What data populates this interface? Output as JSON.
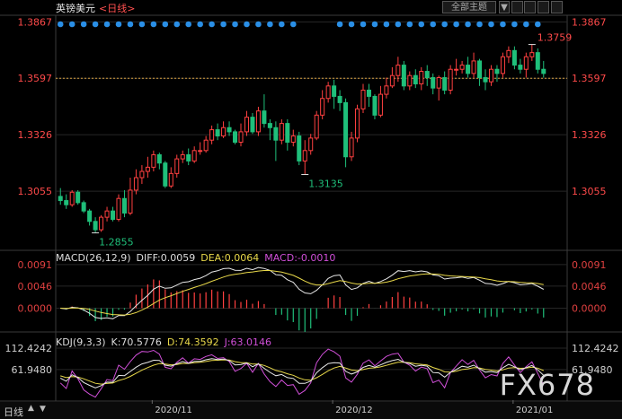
{
  "header": {
    "symbol": "英镑美元",
    "period_label": "<日线>",
    "theme_button": "全部主题",
    "theme_arrow": "▼"
  },
  "footer": {
    "period_tab": "日线",
    "up_icon": "up-triangle-icon",
    "down_icon": "down-triangle-icon"
  },
  "watermark": "FX678",
  "colors": {
    "up": "#ff4040",
    "down": "#1fbf7a",
    "price_label": "#ff4a4a",
    "hist_label": "#e04040",
    "dot": "#2a8fe6",
    "bg": "#000000",
    "grid": "#262626",
    "ma": "#e8d84a",
    "j": "#d04fd8"
  },
  "chart_data": [
    {
      "type": "candlestick",
      "title": "英镑美元<日线>",
      "y_ticks": [
        "1.3867",
        "1.3597",
        "1.3326",
        "1.3055"
      ],
      "ylim": [
        1.281,
        1.3895
      ],
      "current_price_line": 1.3597,
      "annotations": [
        {
          "text": "1.3759",
          "kind": "high"
        },
        {
          "text": "1.3135",
          "kind": "low"
        },
        {
          "text": "1.2855",
          "kind": "low"
        }
      ],
      "x_ticks": [
        "2020/11",
        "2020/12",
        "2021/01"
      ],
      "candles": [
        [
          1.303,
          1.301,
          1.307,
          1.299
        ],
        [
          1.301,
          1.299,
          1.304,
          1.297
        ],
        [
          1.299,
          1.305,
          1.306,
          1.298
        ],
        [
          1.305,
          1.3,
          1.306,
          1.299
        ],
        [
          1.3,
          1.296,
          1.301,
          1.295
        ],
        [
          1.296,
          1.291,
          1.297,
          1.289
        ],
        [
          1.291,
          1.287,
          1.293,
          1.2855
        ],
        [
          1.287,
          1.293,
          1.294,
          1.286
        ],
        [
          1.293,
          1.296,
          1.298,
          1.291
        ],
        [
          1.296,
          1.292,
          1.298,
          1.291
        ],
        [
          1.292,
          1.302,
          1.304,
          1.291
        ],
        [
          1.302,
          1.295,
          1.306,
          1.293
        ],
        [
          1.295,
          1.306,
          1.312,
          1.294
        ],
        [
          1.306,
          1.312,
          1.316,
          1.304
        ],
        [
          1.312,
          1.315,
          1.318,
          1.309
        ],
        [
          1.315,
          1.317,
          1.322,
          1.312
        ],
        [
          1.317,
          1.323,
          1.325,
          1.315
        ],
        [
          1.323,
          1.319,
          1.324,
          1.316
        ],
        [
          1.319,
          1.308,
          1.32,
          1.307
        ],
        [
          1.308,
          1.314,
          1.317,
          1.307
        ],
        [
          1.314,
          1.321,
          1.323,
          1.312
        ],
        [
          1.321,
          1.323,
          1.325,
          1.319
        ],
        [
          1.323,
          1.32,
          1.326,
          1.318
        ],
        [
          1.32,
          1.325,
          1.327,
          1.319
        ],
        [
          1.325,
          1.325,
          1.329,
          1.323
        ],
        [
          1.325,
          1.33,
          1.332,
          1.324
        ],
        [
          1.33,
          1.335,
          1.337,
          1.328
        ],
        [
          1.335,
          1.332,
          1.338,
          1.33
        ],
        [
          1.332,
          1.336,
          1.339,
          1.331
        ],
        [
          1.336,
          1.334,
          1.339,
          1.332
        ],
        [
          1.334,
          1.329,
          1.335,
          1.328
        ],
        [
          1.329,
          1.334,
          1.338,
          1.327
        ],
        [
          1.334,
          1.341,
          1.344,
          1.332
        ],
        [
          1.341,
          1.334,
          1.343,
          1.333
        ],
        [
          1.334,
          1.344,
          1.346,
          1.332
        ],
        [
          1.344,
          1.338,
          1.352,
          1.336
        ],
        [
          1.338,
          1.336,
          1.34,
          1.33
        ],
        [
          1.336,
          1.33,
          1.339,
          1.32
        ],
        [
          1.33,
          1.338,
          1.34,
          1.328
        ],
        [
          1.338,
          1.329,
          1.34,
          1.325
        ],
        [
          1.329,
          1.332,
          1.335,
          1.327
        ],
        [
          1.332,
          1.32,
          1.334,
          1.318
        ],
        [
          1.32,
          1.325,
          1.33,
          1.3135
        ],
        [
          1.325,
          1.331,
          1.333,
          1.323
        ],
        [
          1.331,
          1.342,
          1.344,
          1.33
        ],
        [
          1.342,
          1.35,
          1.354,
          1.34
        ],
        [
          1.35,
          1.356,
          1.358,
          1.348
        ],
        [
          1.356,
          1.351,
          1.359,
          1.345
        ],
        [
          1.351,
          1.348,
          1.354,
          1.344
        ],
        [
          1.348,
          1.322,
          1.35,
          1.317
        ],
        [
          1.322,
          1.331,
          1.334,
          1.32
        ],
        [
          1.331,
          1.345,
          1.347,
          1.329
        ],
        [
          1.345,
          1.354,
          1.357,
          1.343
        ],
        [
          1.354,
          1.351,
          1.357,
          1.346
        ],
        [
          1.351,
          1.342,
          1.352,
          1.34
        ],
        [
          1.342,
          1.352,
          1.356,
          1.341
        ],
        [
          1.352,
          1.356,
          1.36,
          1.35
        ],
        [
          1.356,
          1.361,
          1.365,
          1.355
        ],
        [
          1.361,
          1.366,
          1.37,
          1.358
        ],
        [
          1.366,
          1.356,
          1.368,
          1.354
        ],
        [
          1.356,
          1.361,
          1.363,
          1.354
        ],
        [
          1.361,
          1.357,
          1.364,
          1.355
        ],
        [
          1.357,
          1.363,
          1.365,
          1.354
        ],
        [
          1.363,
          1.36,
          1.366,
          1.356
        ],
        [
          1.36,
          1.355,
          1.362,
          1.352
        ],
        [
          1.355,
          1.36,
          1.361,
          1.349
        ],
        [
          1.36,
          1.354,
          1.363,
          1.352
        ],
        [
          1.354,
          1.364,
          1.366,
          1.352
        ],
        [
          1.364,
          1.364,
          1.369,
          1.361
        ],
        [
          1.364,
          1.366,
          1.368,
          1.362
        ],
        [
          1.366,
          1.362,
          1.37,
          1.36
        ],
        [
          1.362,
          1.368,
          1.372,
          1.36
        ],
        [
          1.368,
          1.36,
          1.369,
          1.356
        ],
        [
          1.36,
          1.358,
          1.364,
          1.354
        ],
        [
          1.358,
          1.364,
          1.366,
          1.356
        ],
        [
          1.364,
          1.362,
          1.366,
          1.358
        ],
        [
          1.362,
          1.37,
          1.372,
          1.36
        ],
        [
          1.37,
          1.373,
          1.375,
          1.367
        ],
        [
          1.373,
          1.366,
          1.375,
          1.364
        ],
        [
          1.366,
          1.364,
          1.369,
          1.362
        ],
        [
          1.364,
          1.37,
          1.372,
          1.36
        ],
        [
          1.37,
          1.372,
          1.3759,
          1.368
        ],
        [
          1.372,
          1.364,
          1.374,
          1.362
        ],
        [
          1.364,
          1.362,
          1.368,
          1.36
        ]
      ]
    },
    {
      "type": "macd",
      "legend": [
        {
          "text": "MACD(26,12,9)",
          "color": "#dddddd"
        },
        {
          "text": "DIFF:0.0059",
          "color": "#dddddd"
        },
        {
          "text": "DEA:0.0064",
          "color": "#e8d84a"
        },
        {
          "text": "MACD:-0.0010",
          "color": "#d04fd8"
        }
      ],
      "y_ticks": [
        "0.0091",
        "0.0046",
        "0.0000"
      ],
      "ylim": [
        -0.0042,
        0.01
      ]
    },
    {
      "type": "kdj",
      "legend": [
        {
          "text": "KDJ(9,3,3)",
          "color": "#dddddd"
        },
        {
          "text": "K:70.5776",
          "color": "#dddddd"
        },
        {
          "text": "D:74.3592",
          "color": "#e8d84a"
        },
        {
          "text": "J:63.0146",
          "color": "#d04fd8"
        }
      ],
      "y_ticks": [
        "112.4242",
        "61.9480"
      ],
      "ylim": [
        -10,
        125
      ]
    }
  ]
}
